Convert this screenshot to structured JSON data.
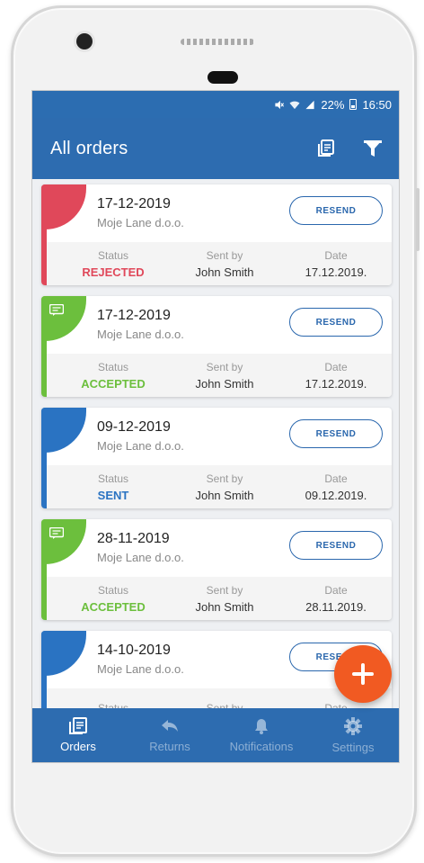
{
  "status_bar": {
    "battery": "22%",
    "time": "16:50"
  },
  "app_bar": {
    "title": "All orders",
    "actions": [
      "reports-icon",
      "filter-icon"
    ]
  },
  "orders": [
    {
      "date": "17-12-2019",
      "company": "Moje Lane d.o.o.",
      "button": "RESEND",
      "status_label": "Status",
      "status": "REJECTED",
      "sent_by_label": "Sent by",
      "sent_by": "John Smith",
      "date_label": "Date",
      "date_value": "17.12.2019.",
      "accent": "#e0485a",
      "has_message": false
    },
    {
      "date": "17-12-2019",
      "company": "Moje Lane d.o.o.",
      "button": "RESEND",
      "status_label": "Status",
      "status": "ACCEPTED",
      "sent_by_label": "Sent by",
      "sent_by": "John Smith",
      "date_label": "Date",
      "date_value": "17.12.2019.",
      "accent": "#6cbf3d",
      "has_message": true
    },
    {
      "date": "09-12-2019",
      "company": "Moje Lane d.o.o.",
      "button": "RESEND",
      "status_label": "Status",
      "status": "SENT",
      "sent_by_label": "Sent by",
      "sent_by": "John Smith",
      "date_label": "Date",
      "date_value": "09.12.2019.",
      "accent": "#2a73c2",
      "has_message": false
    },
    {
      "date": "28-11-2019",
      "company": "Moje Lane d.o.o.",
      "button": "RESEND",
      "status_label": "Status",
      "status": "ACCEPTED",
      "sent_by_label": "Sent by",
      "sent_by": "John Smith",
      "date_label": "Date",
      "date_value": "28.11.2019.",
      "accent": "#6cbf3d",
      "has_message": true
    },
    {
      "date": "14-10-2019",
      "company": "Moje Lane d.o.o.",
      "button": "RESEND",
      "status_label": "Status",
      "status": "",
      "sent_by_label": "Sent by",
      "sent_by": "",
      "date_label": "Date",
      "date_value": "",
      "accent": "#2a73c2",
      "has_message": false
    }
  ],
  "fab": {
    "icon": "plus-icon",
    "color": "#f15a22"
  },
  "bottom_nav": [
    {
      "label": "Orders",
      "icon": "orders-icon",
      "active": true
    },
    {
      "label": "Returns",
      "icon": "reply-icon",
      "active": false
    },
    {
      "label": "Notifications",
      "icon": "bell-icon",
      "active": false
    },
    {
      "label": "Settings",
      "icon": "gear-icon",
      "active": false
    }
  ],
  "colors": {
    "primary": "#2d6cb0",
    "rejected": "#e0485a",
    "accepted": "#6cbf3d",
    "sent": "#2a73c2"
  }
}
